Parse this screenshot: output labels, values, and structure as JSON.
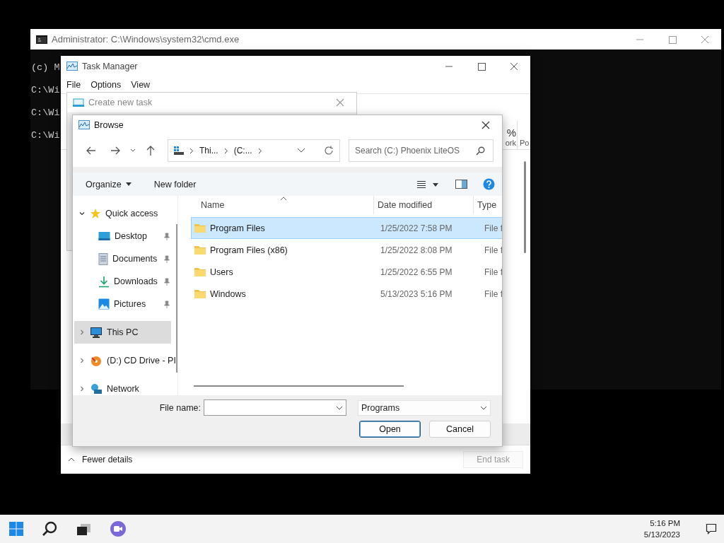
{
  "cmd_window": {
    "title": "Administrator: C:\\Windows\\system32\\cmd.exe",
    "lines": [
      "(c) M",
      "C:\\Wi",
      "C:\\Wi",
      "C:\\Wi"
    ]
  },
  "task_manager": {
    "title": "Task Manager",
    "menu": [
      "File",
      "Options",
      "View"
    ],
    "column_fragments": [
      {
        "value": "%",
        "label": "ork"
      },
      {
        "label": "Po"
      }
    ],
    "footer": {
      "toggle": "Fewer details",
      "end_task": {
        "label": "End task",
        "disabled": true
      }
    }
  },
  "create_task_dialog": {
    "title": "Create new task"
  },
  "browse_dialog": {
    "title": "Browse",
    "address": [
      "Thi...",
      "(C:..."
    ],
    "search": {
      "placeholder": "Search (C:) Phoenix LiteOS"
    },
    "toolbar": {
      "organize": "Organize",
      "new_folder": "New folder"
    },
    "nav_pane": [
      {
        "label": "Quick access",
        "kind": "star",
        "expanded": true,
        "selected": false,
        "children": [
          {
            "label": "Desktop",
            "kind": "desktop",
            "pinned": true
          },
          {
            "label": "Documents",
            "kind": "documents",
            "pinned": true
          },
          {
            "label": "Downloads",
            "kind": "downloads",
            "pinned": true
          },
          {
            "label": "Pictures",
            "kind": "pictures",
            "pinned": true
          }
        ]
      },
      {
        "label": "This PC",
        "kind": "pc",
        "expanded": false,
        "selected": true
      },
      {
        "label": "(D:) CD Drive - PI",
        "kind": "cd",
        "expanded": false,
        "selected": false
      },
      {
        "label": "Network",
        "kind": "network",
        "expanded": false,
        "selected": false
      }
    ],
    "columns": [
      "Name",
      "Date modified",
      "Type"
    ],
    "rows": [
      {
        "name": "Program Files",
        "date": "1/25/2022 7:58 PM",
        "type": "File f",
        "selected": true
      },
      {
        "name": "Program Files (x86)",
        "date": "1/25/2022 8:08 PM",
        "type": "File f",
        "selected": false
      },
      {
        "name": "Users",
        "date": "1/25/2022 6:55 PM",
        "type": "File f",
        "selected": false
      },
      {
        "name": "Windows",
        "date": "5/13/2023 5:16 PM",
        "type": "File f",
        "selected": false
      }
    ],
    "file_name_label": "File name:",
    "file_type": "Programs",
    "buttons": [
      {
        "label": "Open",
        "default": true
      },
      {
        "label": "Cancel",
        "default": false
      }
    ]
  },
  "taskbar": {
    "time": "5:16 PM",
    "date": "5/13/2023"
  }
}
